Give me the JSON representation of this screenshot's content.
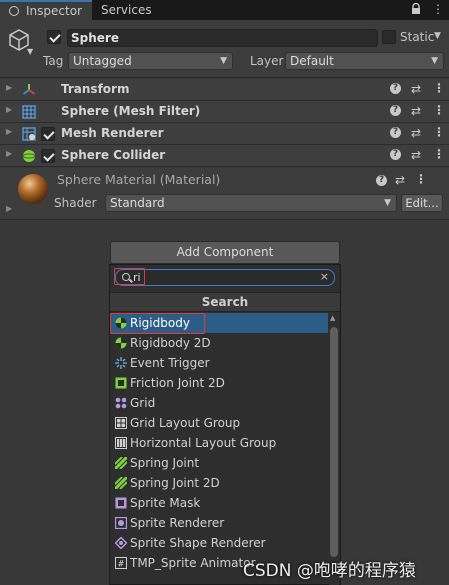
{
  "tabs": {
    "inspector": "Inspector",
    "services": "Services"
  },
  "object": {
    "name": "Sphere",
    "active": true,
    "static_label": "Static"
  },
  "tag": {
    "label": "Tag",
    "value": "Untagged"
  },
  "layer": {
    "label": "Layer",
    "value": "Default"
  },
  "components": [
    {
      "title": "Transform",
      "icon": "transform-icon",
      "has_checkbox": false
    },
    {
      "title": "Sphere (Mesh Filter)",
      "icon": "mesh-filter-icon",
      "has_checkbox": false
    },
    {
      "title": "Mesh Renderer",
      "icon": "mesh-renderer-icon",
      "has_checkbox": true
    },
    {
      "title": "Sphere Collider",
      "icon": "sphere-collider-icon",
      "has_checkbox": true
    }
  ],
  "material": {
    "title": "Sphere Material (Material)",
    "shader_label": "Shader",
    "shader_value": "Standard",
    "edit_label": "Edit..."
  },
  "add_component": {
    "button_label": "Add Component",
    "search_value": "ri",
    "section_header": "Search",
    "results": [
      {
        "label": "Rigidbody",
        "icon": "rigidbody-icon",
        "selected": true
      },
      {
        "label": "Rigidbody 2D",
        "icon": "rigidbody-2d-icon",
        "selected": false
      },
      {
        "label": "Event Trigger",
        "icon": "event-trigger-icon",
        "selected": false
      },
      {
        "label": "Friction Joint 2D",
        "icon": "joint-icon",
        "selected": false
      },
      {
        "label": "Grid",
        "icon": "grid-icon",
        "selected": false
      },
      {
        "label": "Grid Layout Group",
        "icon": "grid-layout-icon",
        "selected": false
      },
      {
        "label": "Horizontal Layout Group",
        "icon": "horizontal-layout-icon",
        "selected": false
      },
      {
        "label": "Spring Joint",
        "icon": "spring-joint-icon",
        "selected": false
      },
      {
        "label": "Spring Joint 2D",
        "icon": "spring-joint-2d-icon",
        "selected": false
      },
      {
        "label": "Sprite Mask",
        "icon": "sprite-mask-icon",
        "selected": false
      },
      {
        "label": "Sprite Renderer",
        "icon": "sprite-renderer-icon",
        "selected": false
      },
      {
        "label": "Sprite Shape Renderer",
        "icon": "sprite-shape-icon",
        "selected": false
      },
      {
        "label": "TMP_Sprite Animator",
        "icon": "script-icon",
        "selected": false
      }
    ]
  },
  "watermark": "CSDN @咆哮的程序猿",
  "colors": {
    "background": "#383838",
    "selection": "#2c5d87",
    "accent": "#3a72b0",
    "highlight": "#e23a3a"
  }
}
